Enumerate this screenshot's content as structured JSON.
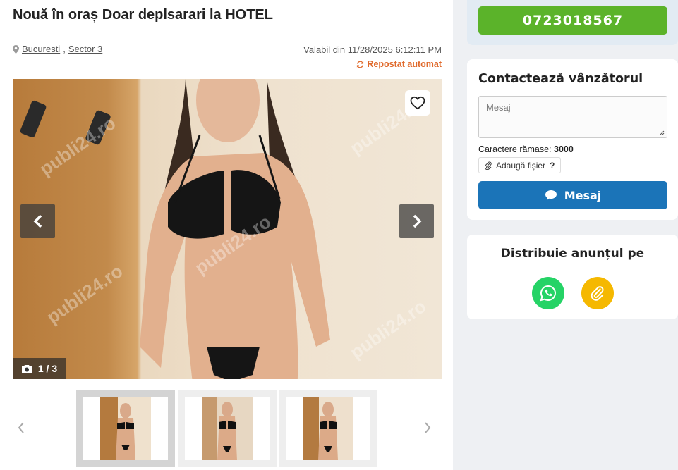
{
  "listing": {
    "title": "Nouă în oraș Doar deplsarari la HOTEL",
    "location_city": "Bucuresti",
    "location_separator": ",",
    "location_sector": "Sector 3",
    "valid_from": "Valabil din 11/28/2025 6:12:11 PM",
    "repost_label": "Repostat automat"
  },
  "gallery": {
    "watermark": "publi24.ro",
    "counter": "1 / 3",
    "thumbnails": [
      "thumb-1",
      "thumb-2",
      "thumb-3"
    ],
    "active_thumbnail": 1
  },
  "contact": {
    "phone": "0723018567",
    "title": "Contactează vânzătorul",
    "message_placeholder": "Mesaj",
    "chars_label": "Caractere rămase:",
    "chars_remaining": "3000",
    "attach_label": "Adaugă fișier",
    "attach_help": "?",
    "send_label": "Mesaj"
  },
  "share": {
    "title": "Distribuie anunțul pe",
    "whatsapp_color": "#25d366",
    "link_color": "#f5b800"
  },
  "colors": {
    "phone_button": "#5bb32a",
    "send_button": "#1b74b8",
    "repost_accent": "#e06a2c"
  }
}
